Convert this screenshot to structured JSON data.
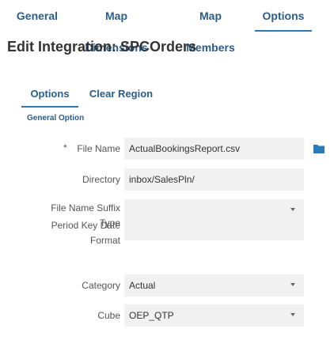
{
  "top_tabs": [
    {
      "label": "General"
    },
    {
      "label": "Map Dimensions"
    },
    {
      "label": "Map Members"
    },
    {
      "label": "Options",
      "active": true
    }
  ],
  "page_title": "Edit Integration: SPCOrders",
  "inner_tabs": [
    {
      "label": "Options",
      "active": true
    },
    {
      "label": "Clear Region"
    }
  ],
  "section_title": "General Option",
  "form": {
    "required_marker": "*",
    "file_name": {
      "label": "File Name",
      "value": "ActualBookingsReport.csv",
      "icon": "folder-icon"
    },
    "directory": {
      "label": "Directory",
      "value": "inbox/SalesPln/"
    },
    "file_name_suffix_type": {
      "label_line1": "File Name Suffix",
      "label_line2": "Type",
      "value": ""
    },
    "period_key_date_format": {
      "label_line1": "Period Key Date",
      "label_line2": "Format",
      "value": ""
    },
    "category": {
      "label": "Category",
      "value": "Actual"
    },
    "cube": {
      "label": "Cube",
      "value": "OEP_QTP"
    }
  },
  "colors": {
    "accent": "#2b7ab8",
    "tab_text": "#2b5d8a",
    "field_bg": "#f1f1f1"
  }
}
